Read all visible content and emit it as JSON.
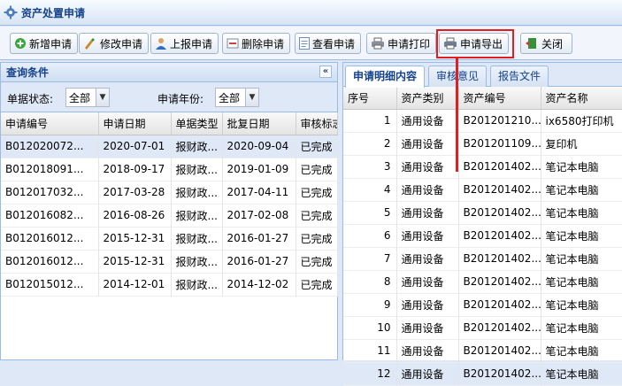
{
  "window": {
    "title": "资产处置申请"
  },
  "toolbar": {
    "add": "新增申请",
    "edit": "修改申请",
    "submit": "上报申请",
    "delete": "删除申请",
    "view": "查看申请",
    "print": "申请打印",
    "export": "申请导出",
    "close": "关闭"
  },
  "query": {
    "title": "查询条件",
    "collapse": "«",
    "status_label": "单据状态:",
    "status_value": "全部",
    "year_label": "申请年份:",
    "year_value": "全部"
  },
  "left_grid": {
    "columns": [
      "申请编号",
      "申请日期",
      "单据类型",
      "批复日期",
      "审核标志"
    ],
    "rows": [
      [
        "B012020072...",
        "2020-07-01",
        "报财政...",
        "2020-09-04",
        "已完成"
      ],
      [
        "B012018091...",
        "2018-09-17",
        "报财政...",
        "2019-01-09",
        "已完成"
      ],
      [
        "B012017032...",
        "2017-03-28",
        "报财政...",
        "2017-04-11",
        "已完成"
      ],
      [
        "B012016082...",
        "2016-08-26",
        "报财政...",
        "2017-02-08",
        "已完成"
      ],
      [
        "B012016012...",
        "2015-12-31",
        "报财政...",
        "2016-01-27",
        "已完成"
      ],
      [
        "B012016012...",
        "2015-12-31",
        "报财政...",
        "2016-01-27",
        "已完成"
      ],
      [
        "B012015012...",
        "2014-12-01",
        "报财政...",
        "2014-12-02",
        "已完成"
      ]
    ]
  },
  "tabs": [
    "申请明细内容",
    "审核意见",
    "报告文件"
  ],
  "right_grid": {
    "columns": [
      "序号",
      "资产类别",
      "资产编号",
      "资产名称"
    ],
    "rows": [
      [
        "1",
        "通用设备",
        "B201201210...",
        "ix6580打印机"
      ],
      [
        "2",
        "通用设备",
        "B201201109...",
        "复印机"
      ],
      [
        "3",
        "通用设备",
        "B201201402...",
        "笔记本电脑"
      ],
      [
        "4",
        "通用设备",
        "B201201402...",
        "笔记本电脑"
      ],
      [
        "5",
        "通用设备",
        "B201201402...",
        "笔记本电脑"
      ],
      [
        "6",
        "通用设备",
        "B201201402...",
        "笔记本电脑"
      ],
      [
        "7",
        "通用设备",
        "B201201402...",
        "笔记本电脑"
      ],
      [
        "8",
        "通用设备",
        "B201201402...",
        "笔记本电脑"
      ],
      [
        "9",
        "通用设备",
        "B201201402...",
        "笔记本电脑"
      ],
      [
        "10",
        "通用设备",
        "B201201402...",
        "笔记本电脑"
      ],
      [
        "11",
        "通用设备",
        "B201201402...",
        "笔记本电脑"
      ],
      [
        "12",
        "通用设备",
        "B201201402...",
        "笔记本电脑"
      ]
    ]
  },
  "icons": [
    "gear-icon",
    "add-icon",
    "edit-icon",
    "user-upload-icon",
    "delete-icon",
    "document-icon",
    "printer-icon",
    "export-icon",
    "exit-icon"
  ],
  "colors": {
    "header_blue": "#15428b",
    "border": "#99bbe8",
    "highlight_red": "#e02020",
    "selected_row": "#dfe8f6"
  }
}
